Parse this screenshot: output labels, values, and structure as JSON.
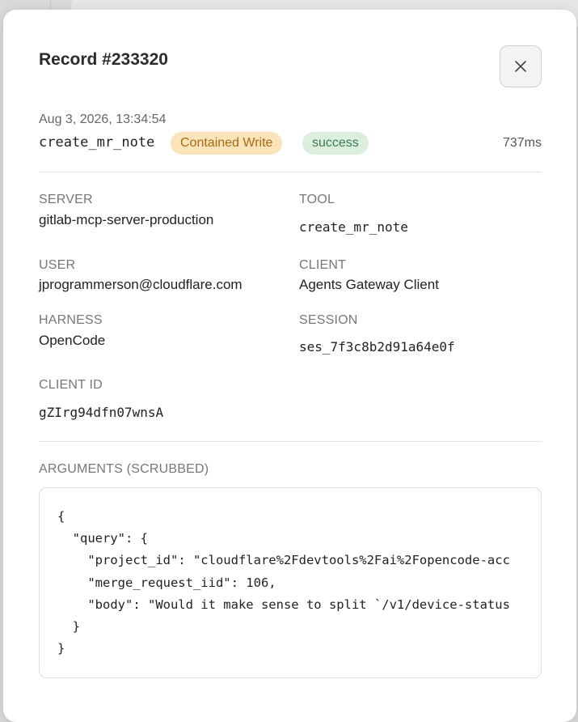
{
  "modal": {
    "title": "Record #233320",
    "close_icon": "close-icon"
  },
  "summary": {
    "timestamp": "Aug 3, 2026, 13:34:54",
    "tool": "create_mr_note",
    "type_badge": "Contained Write",
    "status_badge": "success",
    "duration": "737ms",
    "colors": {
      "type_badge_bg": "#fbe4b9",
      "type_badge_text": "#a66a12",
      "status_badge_bg": "#dcefdf",
      "status_badge_text": "#3d7a4b"
    }
  },
  "details": {
    "server_label": "SERVER",
    "server_value": "gitlab-mcp-server-production",
    "tool_label": "TOOL",
    "tool_value": "create_mr_note",
    "user_label": "USER",
    "user_value": "jprogrammerson@cloudflare.com",
    "client_label": "CLIENT",
    "client_value": "Agents Gateway Client",
    "harness_label": "HARNESS",
    "harness_value": "OpenCode",
    "session_label": "SESSION",
    "session_value": "ses_7f3c8b2d91a64e0f",
    "client_id_label": "CLIENT ID",
    "client_id_value": "gZIrg94dfn07wnsA"
  },
  "arguments": {
    "label": "ARGUMENTS (SCRUBBED)",
    "code": "{\n  \"query\": {\n    \"project_id\": \"cloudflare%2Fdevtools%2Fai%2Fopencode-acc\n    \"merge_request_iid\": 106,\n    \"body\": \"Would it make sense to split `/v1/device-status\n  }\n}"
  }
}
